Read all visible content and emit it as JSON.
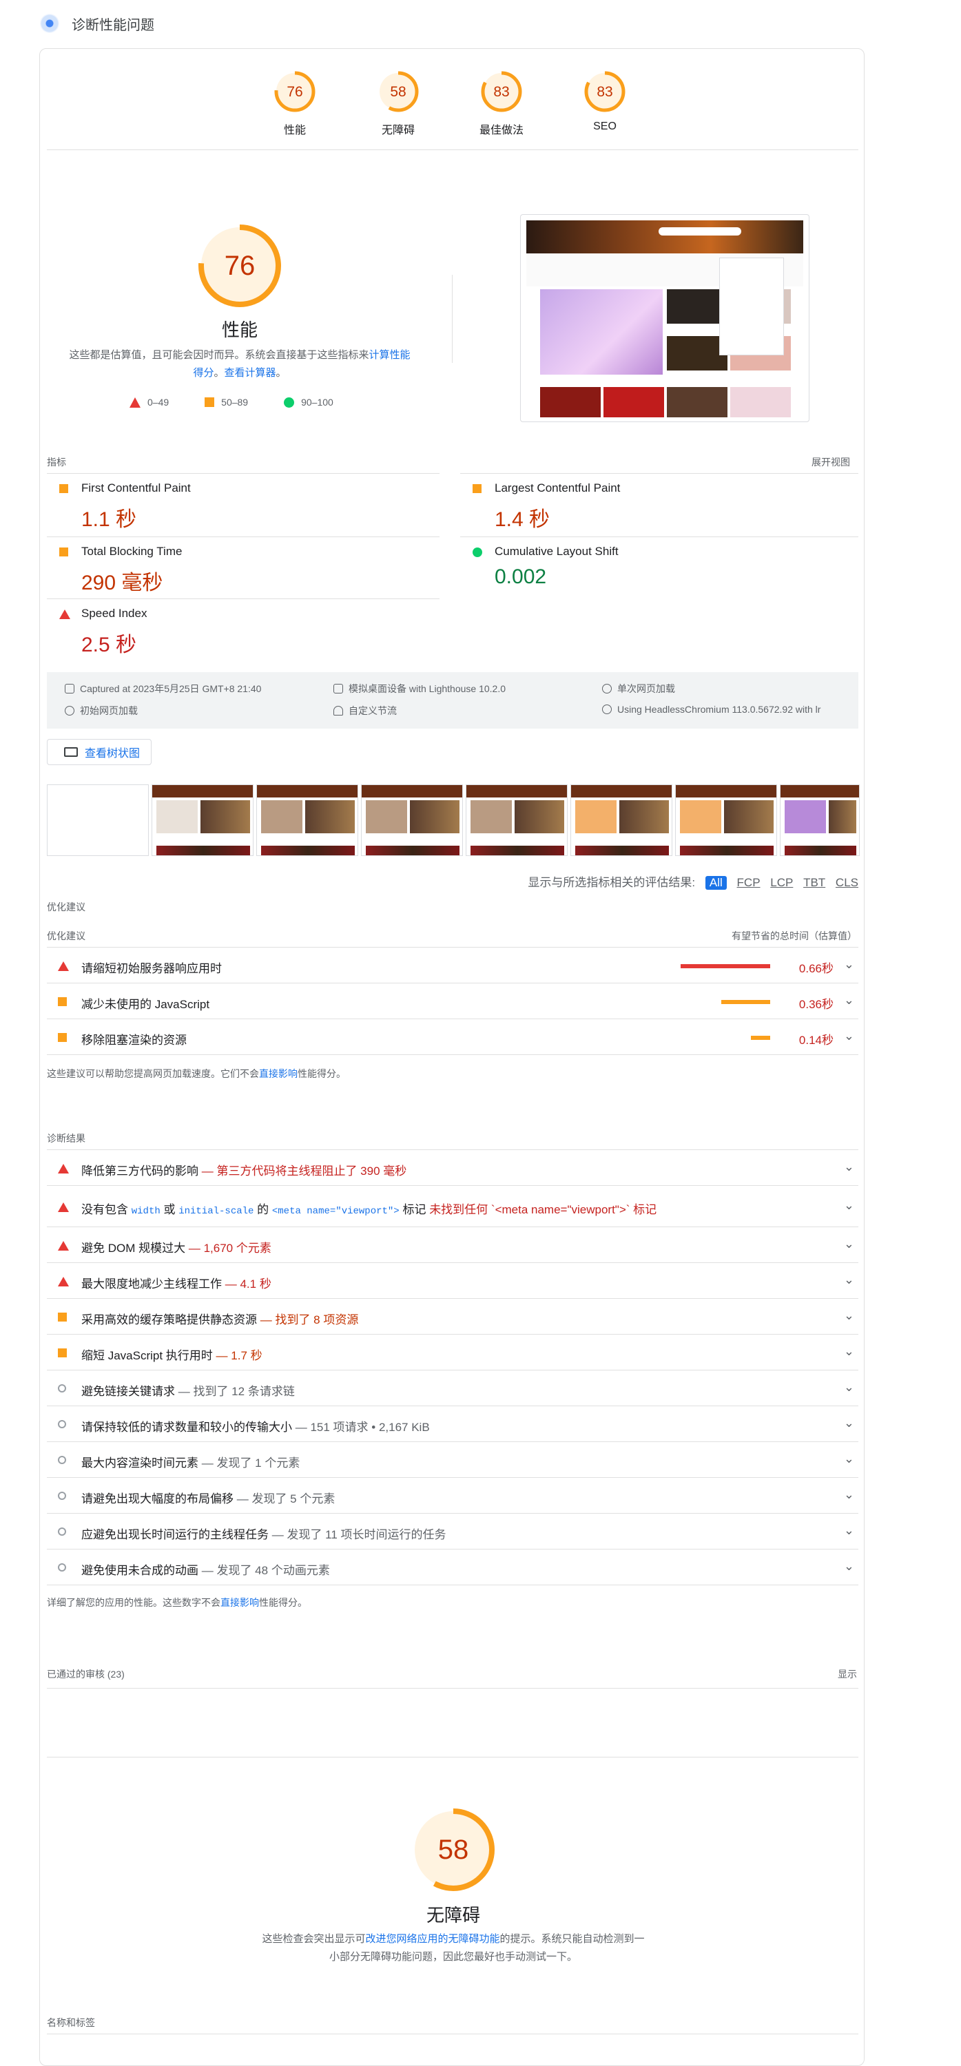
{
  "app": {
    "title": "诊断性能问题"
  },
  "colors": {
    "fail": "#e53935",
    "average": "#fa9f1b",
    "pass": "#0cce6b",
    "gauge_bg": "#fff3e0"
  },
  "gauges": [
    {
      "score": "76",
      "label": "性能",
      "fraction": 0.76
    },
    {
      "score": "58",
      "label": "无障碍",
      "fraction": 0.58
    },
    {
      "score": "83",
      "label": "最佳做法",
      "fraction": 0.83
    },
    {
      "score": "83",
      "label": "SEO",
      "fraction": 0.83
    }
  ],
  "performance": {
    "score": "76",
    "fraction": 0.76,
    "title": "性能",
    "desc_pre": "这些都是估算值，且可能会因时而异。系统会直接基于这些指标来",
    "desc_link1": "计算性能得分",
    "desc_mid": "。",
    "desc_link2": "查看计算器",
    "desc_post": "。",
    "legend": [
      "0–49",
      "50–89",
      "90–100"
    ]
  },
  "metrics": {
    "label": "指标",
    "expand": "展开视图",
    "items": [
      {
        "name": "First Contentful Paint",
        "value": "1.1 秒",
        "rating": "average"
      },
      {
        "name": "Largest Contentful Paint",
        "value": "1.4 秒",
        "rating": "average"
      },
      {
        "name": "Total Blocking Time",
        "value": "290 毫秒",
        "rating": "average"
      },
      {
        "name": "Cumulative Layout Shift",
        "value": "0.002",
        "rating": "pass"
      },
      {
        "name": "Speed Index",
        "value": "2.5 秒",
        "rating": "fail"
      }
    ]
  },
  "environment": {
    "captured": "Captured at 2023年5月25日 GMT+8 21:40",
    "device": "模拟桌面设备 with Lighthouse 10.2.0",
    "session": "单次网页加载",
    "initial": "初始网页加载",
    "throttling": "自定义节流",
    "browser": "Using HeadlessChromium 113.0.5672.92 with lr"
  },
  "treemap_label": "查看树状图",
  "filter": {
    "label": "显示与所选指标相关的评估结果:",
    "chips": [
      "All",
      "FCP",
      "LCP",
      "TBT",
      "CLS"
    ]
  },
  "opportunities": {
    "label": "优化建议",
    "col_left": "优化建议",
    "col_right": "有望节省的总时间（估算值）",
    "items": [
      {
        "title": "请缩短初始服务器响应用时",
        "saving": "0.66秒",
        "saving_seconds": 0.66,
        "rating": "fail"
      },
      {
        "title": "减少未使用的 JavaScript",
        "saving": "0.36秒",
        "saving_seconds": 0.36,
        "rating": "average"
      },
      {
        "title": "移除阻塞渲染的资源",
        "saving": "0.14秒",
        "saving_seconds": 0.14,
        "rating": "average"
      }
    ],
    "note_pre": "这些建议可以帮助您提高网页加载速度。它们不会",
    "note_link": "直接影响",
    "note_post": "性能得分。"
  },
  "diagnostics": {
    "label": "诊断结果",
    "items": [
      {
        "title": "降低第三方代码的影响",
        "detail": "— 第三方代码将主线程阻止了 390 毫秒",
        "rating": "fail"
      },
      {
        "title_a": "没有包含 ",
        "code1": "width",
        "title_b": " 或 ",
        "code2": "initial-scale",
        "title_c": " 的 ",
        "code3": "<meta name=\"viewport\">",
        "title_d": " 标记",
        "detail": "未找到任何 `<meta name=\"viewport\">` 标记",
        "rating": "fail"
      },
      {
        "title": "避免 DOM 规模过大",
        "detail": "— 1,670 个元素",
        "rating": "fail"
      },
      {
        "title": "最大限度地减少主线程工作",
        "detail": "— 4.1 秒",
        "rating": "fail"
      },
      {
        "title": "采用高效的缓存策略提供静态资源",
        "detail": "— 找到了 8 项资源",
        "rating": "average"
      },
      {
        "title": "缩短 JavaScript 执行用时",
        "detail": "— 1.7 秒",
        "rating": "average"
      },
      {
        "title": "避免链接关键请求",
        "detail": "— 找到了 12 条请求链",
        "rating": "info"
      },
      {
        "title": "请保持较低的请求数量和较小的传输大小",
        "detail": "— 151 项请求 • 2,167 KiB",
        "rating": "info"
      },
      {
        "title": "最大内容渲染时间元素",
        "detail": "— 发现了 1 个元素",
        "rating": "info"
      },
      {
        "title": "请避免出现大幅度的布局偏移",
        "detail": "— 发现了 5 个元素",
        "rating": "info"
      },
      {
        "title": "应避免出现长时间运行的主线程任务",
        "detail": "— 发现了 11 项长时间运行的任务",
        "rating": "info"
      },
      {
        "title": "避免使用未合成的动画",
        "detail": "— 发现了 48 个动画元素",
        "rating": "info"
      }
    ],
    "note_pre": "详细了解您的应用的性能。这些数字不会",
    "note_link": "直接影响",
    "note_post": "性能得分。"
  },
  "passed": {
    "label": "已通过的审核",
    "count": "(23)",
    "toggle": "显示"
  },
  "accessibility": {
    "score": "58",
    "fraction": 0.58,
    "title": "无障碍",
    "desc_pre": "这些检查会突出显示可",
    "desc_link": "改进您网络应用的无障碍功能",
    "desc_post": "的提示。系统只能自动检测到一小部分无障碍功能问题，因此您最好也手动测试一下。",
    "group": "名称和标签"
  }
}
